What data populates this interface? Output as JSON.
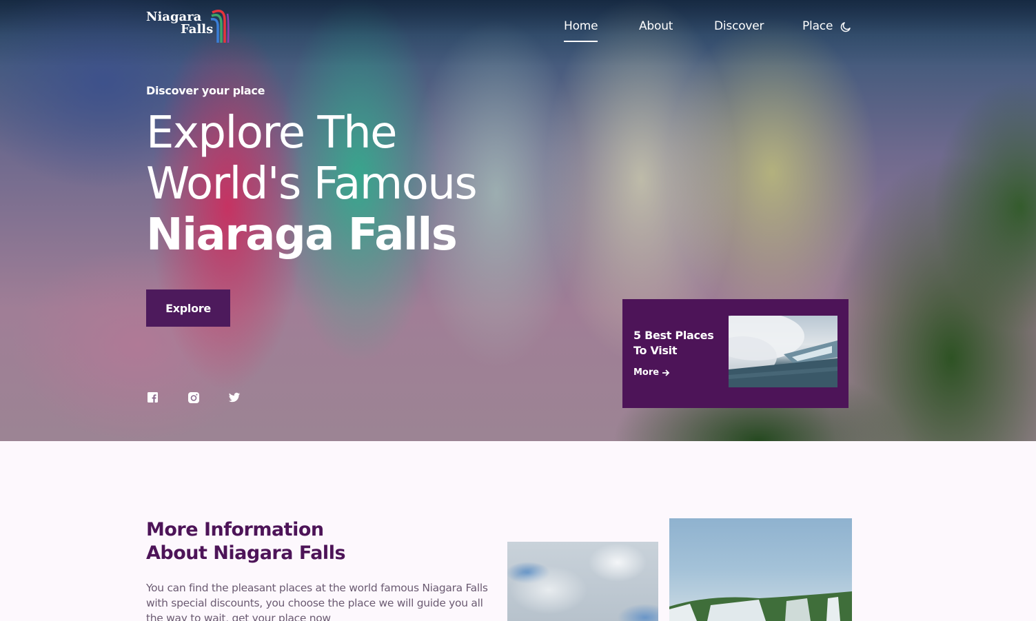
{
  "logo": {
    "line1": "Niagara",
    "line2": "Falls"
  },
  "nav": {
    "items": [
      {
        "label": "Home",
        "active": true
      },
      {
        "label": "About",
        "active": false
      },
      {
        "label": "Discover",
        "active": false
      },
      {
        "label": "Place",
        "active": false
      }
    ],
    "theme_icon": "moon-icon"
  },
  "hero": {
    "subtitle": "Discover your place",
    "title_line1": "Explore The",
    "title_line2": "World's Famous",
    "title_line3": "Niaraga Falls",
    "button_label": "Explore",
    "social_icons": [
      "facebook-icon",
      "instagram-icon",
      "twitter-icon"
    ]
  },
  "card": {
    "title": "5 Best Places To Visit",
    "more_label": "More"
  },
  "info": {
    "title_line1": "More Information",
    "title_line2": "About Niagara Falls",
    "text": "You can find the pleasant places at the world famous Niagara Falls with special discounts, you choose the place we will guide you all the way to wait, get your place now"
  },
  "colors": {
    "primary": "#4d1458",
    "button": "#4d1a5c",
    "section_bg": "#fdf8fd",
    "body_text": "#6b5b72"
  }
}
